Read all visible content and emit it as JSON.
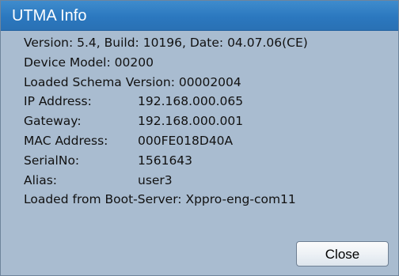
{
  "dialog": {
    "title": "UTMA Info"
  },
  "info": {
    "version_line": "Version: 5.4, Build: 10196, Date: 04.07.06(CE)",
    "device_model_line": "Device Model: 00200",
    "schema_version_line": "Loaded Schema Version: 00002004",
    "ip_address": {
      "label": "IP Address:",
      "value": "192.168.000.065"
    },
    "gateway": {
      "label": "Gateway:",
      "value": "192.168.000.001"
    },
    "mac_address": {
      "label": "MAC Address:",
      "value": "000FE018D40A"
    },
    "serial_no": {
      "label": "SerialNo:",
      "value": "1561643"
    },
    "alias": {
      "label": "Alias:",
      "value": "user3"
    },
    "boot_server_line": "Loaded from Boot-Server: Xppro-eng-com11"
  },
  "buttons": {
    "close": "Close"
  }
}
